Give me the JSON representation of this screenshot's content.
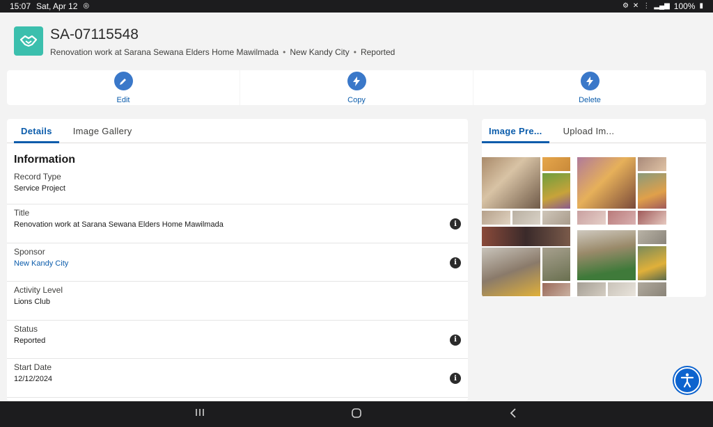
{
  "status_bar": {
    "time": "15:07",
    "date": "Sat, Apr 12",
    "battery": "100%"
  },
  "record": {
    "id": "SA-07115548",
    "title_line": "Renovation work at Sarana Sewana Elders Home Mawilmada",
    "sponsor": "New Kandy City",
    "status": "Reported",
    "separator": "•"
  },
  "actions": [
    {
      "label": "Edit",
      "icon": "pencil-icon"
    },
    {
      "label": "Copy",
      "icon": "lightning-icon"
    },
    {
      "label": "Delete",
      "icon": "lightning-icon"
    }
  ],
  "details": {
    "tabs": [
      "Details",
      "Image Gallery"
    ],
    "active_tab": "Details",
    "section_title": "Information",
    "fields": [
      {
        "label": "Record Type",
        "value": "Service Project",
        "link": false,
        "info": false
      },
      {
        "label": "Title",
        "value": "Renovation work at Sarana Sewana Elders Home Mawilmada",
        "link": false,
        "info": true
      },
      {
        "label": "Sponsor",
        "value": "New Kandy City",
        "link": true,
        "info": true
      },
      {
        "label": "Activity Level",
        "value": "Lions Club",
        "link": false,
        "info": false
      },
      {
        "label": "Status",
        "value": "Reported",
        "link": false,
        "info": true
      },
      {
        "label": "Start Date",
        "value": "12/12/2024",
        "link": false,
        "info": true
      }
    ]
  },
  "preview": {
    "tabs": [
      "Image Pre...",
      "Upload Im..."
    ],
    "active_tab": "Image Pre..."
  },
  "colors": {
    "accent": "#0b5cab",
    "record_icon": "#3bbfad",
    "action_circle": "#3a78c9"
  }
}
